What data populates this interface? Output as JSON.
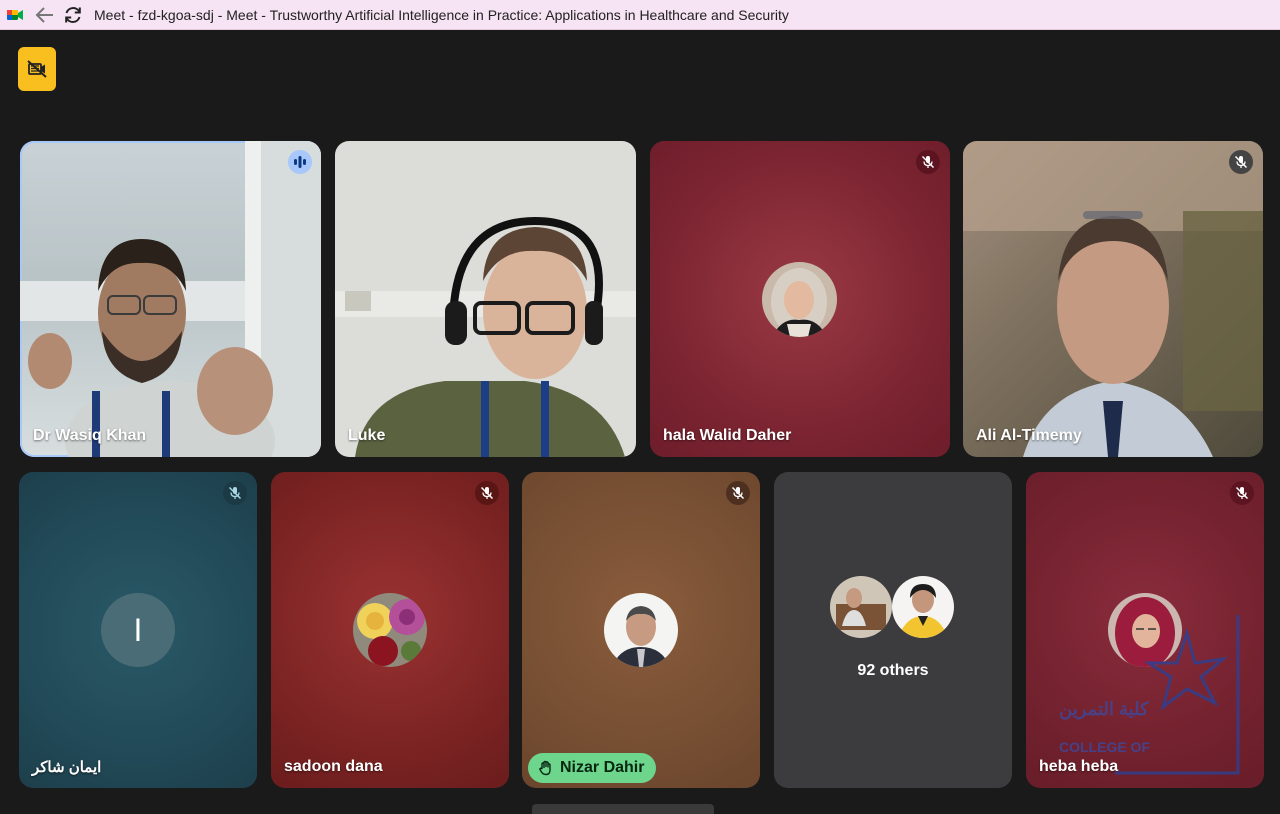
{
  "titlebar": {
    "title": "Meet - fzd-kgoa-sdj - Meet - Trustworthy Artificial Intelligence in Practice: Applications in Healthcare and Security"
  },
  "top_row": [
    {
      "name": "Dr Wasiq Khan",
      "status": "speaking"
    },
    {
      "name": "Luke",
      "status": "video"
    },
    {
      "name": "hala Walid Daher",
      "status": "muted"
    },
    {
      "name": "Ali Al-Timemy",
      "status": "muted"
    }
  ],
  "bottom_row": [
    {
      "name": "ايمان شاكر",
      "initial": "I",
      "status": "muted"
    },
    {
      "name": "sadoon dana",
      "status": "muted"
    },
    {
      "name": "Nizar Dahir",
      "status": "muted",
      "hand_raised": true
    },
    {
      "others_label": "92 others"
    },
    {
      "name": "heba heba",
      "status": "muted"
    }
  ],
  "watermark": {
    "arabic": "كلية التمرين",
    "english": "COLLEGE OF"
  },
  "colors": {
    "titlebar_bg": "#f6e3f3",
    "stage_bg": "#1a1a1a",
    "camera_badge": "#f8bf1f",
    "hand_raised": "#6dd58c",
    "tile_red": "#8b2b35",
    "tile_teal": "#244e5c",
    "tile_brown": "#7a5132",
    "tile_grey": "#3c3c3e"
  }
}
